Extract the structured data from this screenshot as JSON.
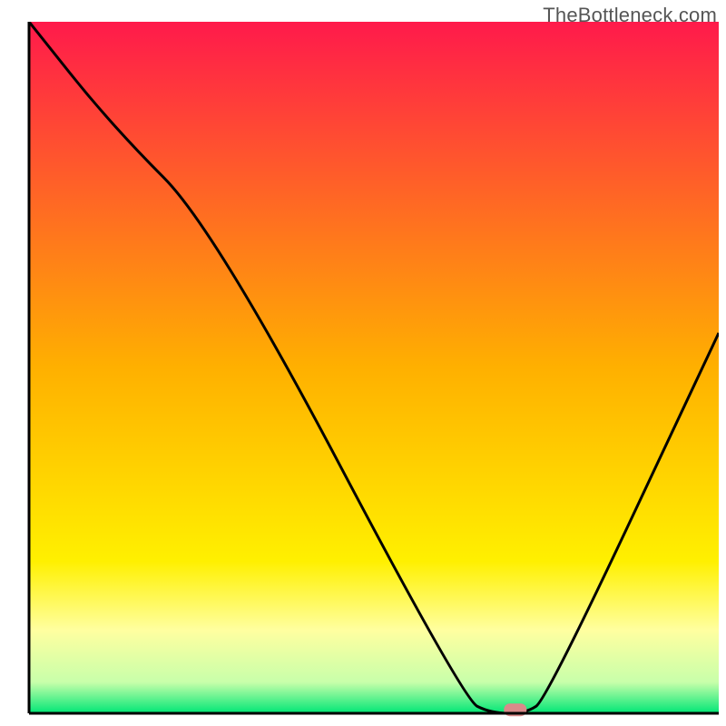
{
  "watermark": "TheBottleneck.com",
  "colors": {
    "axis": "#000000",
    "curve": "#000000",
    "marker_fill": "#d98a8a",
    "marker_stroke": "#d98a8a"
  },
  "chart_data": {
    "type": "line",
    "title": "",
    "xlabel": "",
    "ylabel": "",
    "xlim": [
      0,
      100
    ],
    "ylim": [
      0,
      100
    ],
    "grid": false,
    "watermark": "TheBottleneck.com",
    "background_gradient": [
      {
        "at": 0,
        "color": "#ff1a4b"
      },
      {
        "at": 0.5,
        "color": "#ffb000"
      },
      {
        "at": 0.78,
        "color": "#fff000"
      },
      {
        "at": 0.88,
        "color": "#ffffa0"
      },
      {
        "at": 0.955,
        "color": "#c8ffaa"
      },
      {
        "at": 1.0,
        "color": "#00e676"
      }
    ],
    "series": [
      {
        "name": "bottleneck-curve",
        "x": [
          0,
          12,
          27,
          63,
          67,
          72,
          75,
          100
        ],
        "y": [
          100,
          85,
          70,
          2,
          0,
          0,
          2,
          55
        ]
      }
    ],
    "marker": {
      "x": 70.5,
      "y": 0.5
    }
  }
}
